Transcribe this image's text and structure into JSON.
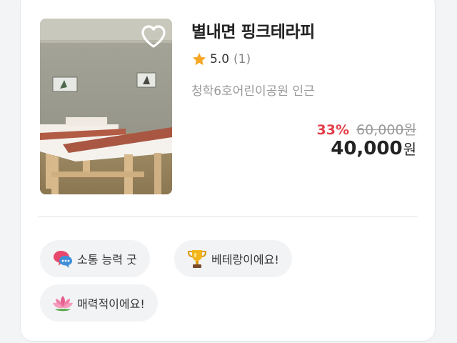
{
  "listing": {
    "title": "별내면 핑크테라피",
    "rating": {
      "score": "5.0",
      "count": "(1)",
      "icon": "star-icon",
      "color": "#f5a623"
    },
    "location": "청학6호어린이공원 인근",
    "price": {
      "discount": "33%",
      "original": "60,000원",
      "final_amount": "40,000",
      "final_unit": "원",
      "discount_color": "#e53e4a"
    },
    "favorite_icon": "heart-outline-icon"
  },
  "tags": [
    {
      "label": "소통 능력 굿",
      "icon": "speech-bubbles-icon"
    },
    {
      "label": "베테랑이에요!",
      "icon": "trophy-icon"
    },
    {
      "label": "매력적이에요!",
      "icon": "lotus-icon"
    }
  ]
}
